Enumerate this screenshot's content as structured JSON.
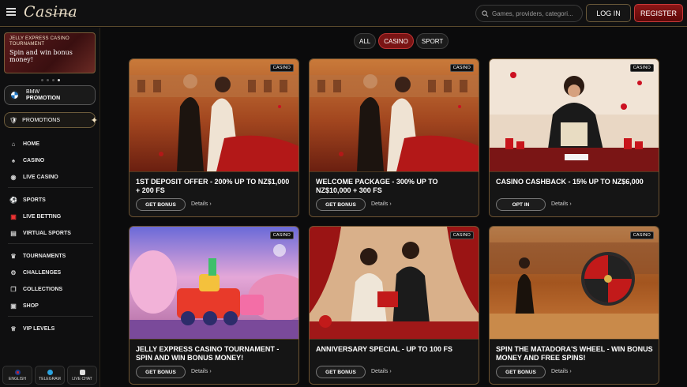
{
  "header": {
    "logo": "Casina",
    "search_placeholder": "Games, providers, categori...",
    "login": "LOG IN",
    "register": "REGISTER"
  },
  "sidebar": {
    "banner": {
      "small": "JELLY EXPRESS CASINO TOURNAMENT",
      "big": "Spin and win bonus money!"
    },
    "bmw": {
      "line1": "BMW",
      "line2": "PROMOTION"
    },
    "promotions": "PROMOTIONS",
    "items": [
      {
        "label": "HOME",
        "icon": "home-icon"
      },
      {
        "label": "CASINO",
        "icon": "cards-icon"
      },
      {
        "label": "LIVE CASINO",
        "icon": "live-casino-icon"
      },
      {
        "label": "SPORTS",
        "icon": "soccer-ball-icon"
      },
      {
        "label": "LIVE BETTING",
        "icon": "live-betting-icon"
      },
      {
        "label": "VIRTUAL SPORTS",
        "icon": "virtual-sports-icon"
      },
      {
        "label": "TOURNAMENTS",
        "icon": "trophy-icon"
      },
      {
        "label": "CHALLENGES",
        "icon": "challenges-icon"
      },
      {
        "label": "COLLECTIONS",
        "icon": "collections-icon"
      },
      {
        "label": "SHOP",
        "icon": "shop-icon"
      },
      {
        "label": "VIP LEVELS",
        "icon": "vip-icon"
      }
    ],
    "footer": [
      {
        "label": "ENGLISH",
        "icon": "flag-icon"
      },
      {
        "label": "TELEGRAM",
        "icon": "telegram-icon"
      },
      {
        "label": "LIVE CHAT",
        "icon": "chat-icon"
      }
    ]
  },
  "tabs": [
    "ALL",
    "CASINO",
    "SPORT"
  ],
  "active_tab": "CASINO",
  "cards": [
    {
      "badge": "CASINO",
      "title": "1ST DEPOSIT OFFER - 200% UP TO NZ$1,000 + 200 FS",
      "button": "GET BONUS",
      "link": "Details ›"
    },
    {
      "badge": "CASINO",
      "title": "WELCOME PACKAGE - 300% UP TO NZ$10,000 + 300 FS",
      "button": "GET BONUS",
      "link": "Details ›"
    },
    {
      "badge": "CASINO",
      "title": "CASINO CASHBACK - 15% UP TO NZ$6,000",
      "button": "OPT IN",
      "link": "Details ›"
    },
    {
      "badge": "CASINO",
      "title": "JELLY EXPRESS CASINO TOURNAMENT - SPIN AND WIN BONUS MONEY!",
      "button": "GET BONUS",
      "link": "Details ›"
    },
    {
      "badge": "CASINO",
      "title": "ANNIVERSARY SPECIAL - UP TO 100 FS",
      "button": "GET BONUS",
      "link": "Details ›"
    },
    {
      "badge": "CASINO",
      "title": "SPIN THE MATADORA'S WHEEL - WIN BONUS MONEY AND FREE SPINS!",
      "button": "GET BONUS",
      "link": "Details ›"
    }
  ],
  "colors": {
    "accent_red": "#7a1414",
    "gold_border": "#6e5432",
    "background": "#0b0b0c"
  }
}
